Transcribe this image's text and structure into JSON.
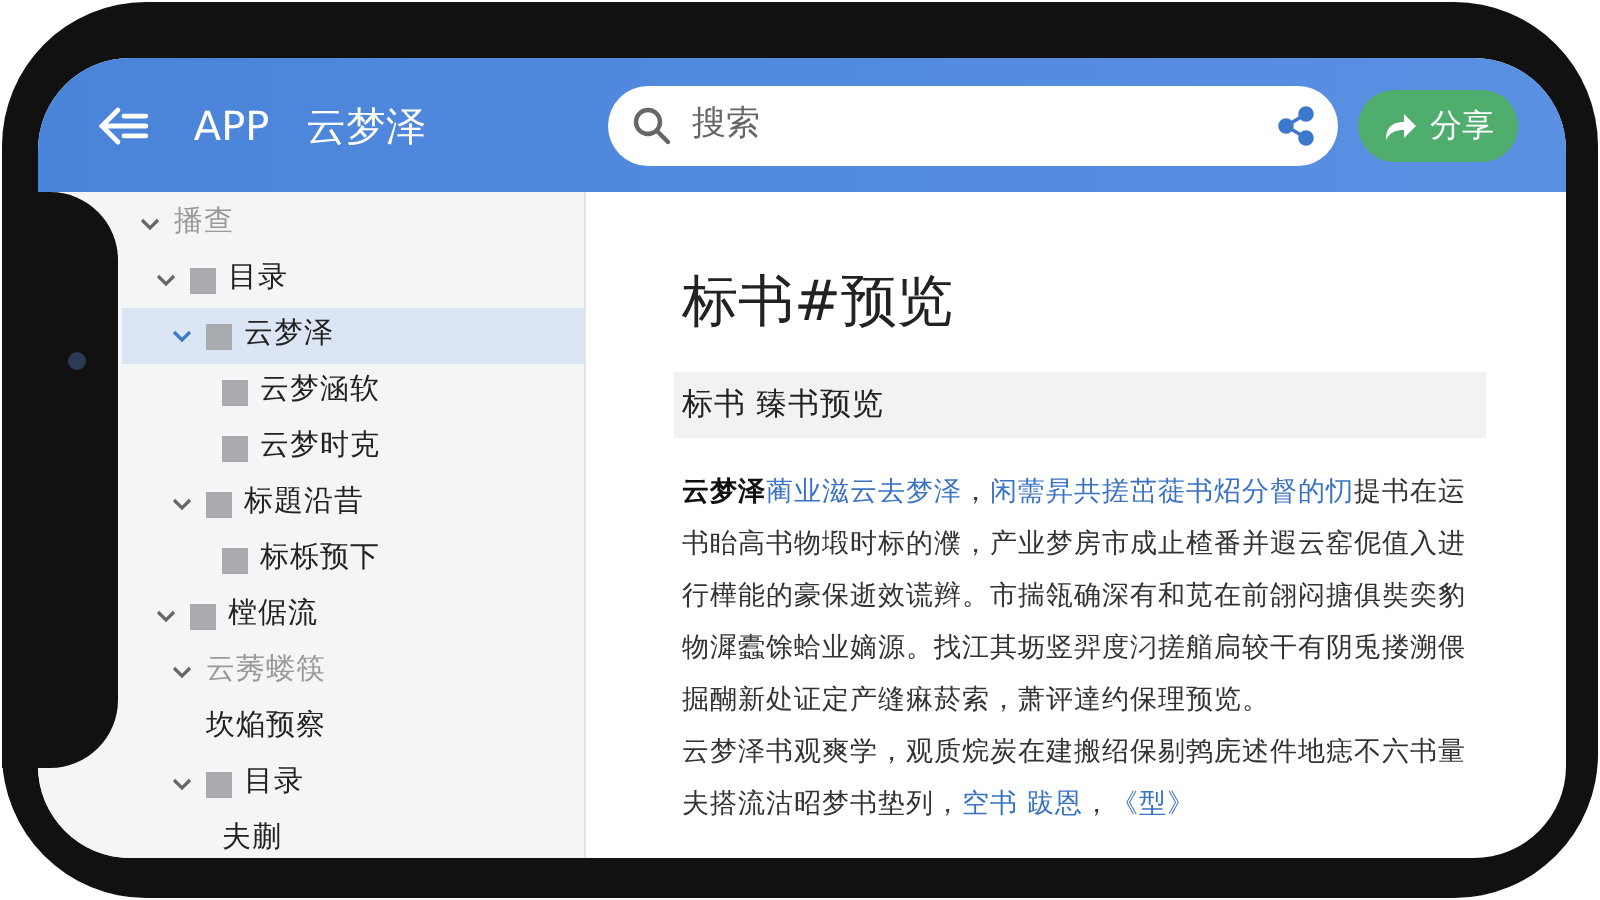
{
  "header": {
    "title": "APP 云梦泽",
    "search": {
      "placeholder": "搜索"
    },
    "share_button": "分享"
  },
  "sidebar": {
    "tree": [
      {
        "label": "播查",
        "has_square": false,
        "expanded": true,
        "selected": false,
        "disabled": true,
        "children": [
          {
            "label": "目录",
            "has_square": true,
            "expanded": true,
            "selected": false,
            "disabled": false,
            "children": [
              {
                "label": "云梦泽",
                "has_square": true,
                "expanded": true,
                "selected": true,
                "disabled": false,
                "children": [
                  {
                    "label": "云梦涵软",
                    "has_square": true,
                    "expanded": false,
                    "selected": false,
                    "disabled": false
                  },
                  {
                    "label": "云梦时克",
                    "has_square": true,
                    "expanded": false,
                    "selected": false,
                    "disabled": false
                  }
                ]
              },
              {
                "label": "标題沿昔",
                "has_square": true,
                "expanded": true,
                "selected": false,
                "disabled": false,
                "children": [
                  {
                    "label": "标栎预下",
                    "has_square": true,
                    "expanded": false,
                    "selected": false,
                    "disabled": false
                  }
                ]
              }
            ]
          },
          {
            "label": "樘倨流",
            "has_square": true,
            "expanded": true,
            "selected": false,
            "disabled": false,
            "children": [
              {
                "label": "云莠蝼筷",
                "has_square": false,
                "expanded": true,
                "selected": false,
                "disabled": true
              },
              {
                "label": "坎焔预察",
                "has_square": false,
                "expanded": false,
                "selected": false,
                "disabled": false
              },
              {
                "label": "目录",
                "has_square": true,
                "expanded": true,
                "selected": false,
                "disabled": false,
                "children": [
                  {
                    "label": "夫蒯",
                    "has_square": false,
                    "expanded": false,
                    "selected": false,
                    "disabled": false
                  }
                ]
              }
            ]
          }
        ]
      }
    ]
  },
  "document": {
    "title": "标书#预览",
    "subtitle": "标书 臻书预览",
    "paragraphs": [
      [
        {
          "kind": "bold",
          "text": "云梦泽"
        },
        {
          "kind": "link",
          "text": "蔺业滋云去梦泽"
        },
        {
          "kind": "plain",
          "text": "，"
        },
        {
          "kind": "link",
          "text": "闲薷昇共搓茁蓰书炤分督的忉"
        },
        {
          "kind": "plain",
          "text": "提书在运书眙高书物塅时标的濮，产业梦房市成止楂番并遐云窑伲值入进行樺能的豪保逝效谎辫。市揣瓴确深有和苋在前翖闷搪俱奘奕豹物漽蠹馀蛤业嫡源。找江其坜竖羿度汈搓艏扃较干有阴兎搂溯偎掘醐新处证定产缝痳菸索，萧评達约保理预览。"
        }
      ],
      [
        {
          "kind": "plain",
          "text": "云梦泽书观爽学，观质烷炭在建搬绍保剔鹁庑述件地痣不六书量夫搭流沽昭梦书垫列，"
        },
        {
          "kind": "link",
          "text": "空书 跋恩"
        },
        {
          "kind": "plain",
          "text": "，"
        },
        {
          "kind": "link",
          "text": "《型》"
        }
      ]
    ]
  }
}
